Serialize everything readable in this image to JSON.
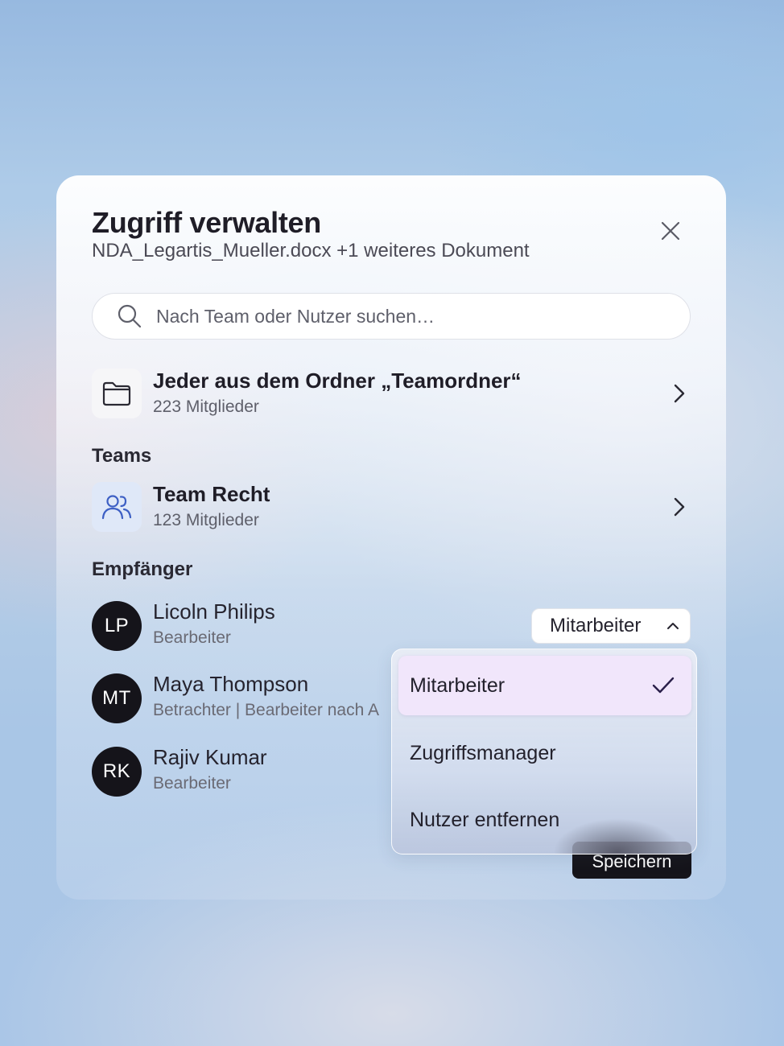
{
  "dialog": {
    "title": "Zugriff verwalten",
    "subtitle": "NDA_Legartis_Mueller.docx +1 weiteres Dokument"
  },
  "search": {
    "placeholder": "Nach Team oder Nutzer suchen…"
  },
  "folder": {
    "title": "Jeder aus dem Ordner „Teamordner“",
    "members": "223 Mitglieder"
  },
  "teams": {
    "label": "Teams",
    "items": [
      {
        "name": "Team Recht",
        "members": "123 Mitglieder"
      }
    ]
  },
  "recipients": {
    "label": "Empfänger",
    "items": [
      {
        "initials": "LP",
        "name": "Licoln Philips",
        "role": "Bearbeiter"
      },
      {
        "initials": "MT",
        "name": "Maya Thompson",
        "role": "Betrachter | Bearbeiter nach A"
      },
      {
        "initials": "RK",
        "name": "Rajiv Kumar",
        "role": "Bearbeiter"
      }
    ]
  },
  "role_select": {
    "value": "Mitarbeiter"
  },
  "dropdown": {
    "options": [
      {
        "label": "Mitarbeiter",
        "selected": true
      },
      {
        "label": "Zugriffsmanager",
        "selected": false
      },
      {
        "label": "Nutzer entfernen",
        "selected": false
      }
    ]
  },
  "actions": {
    "save_label": "Speichern"
  },
  "colors": {
    "accent_team_icon": "#3d5fc4",
    "avatar_bg": "#15141a",
    "selected_option_bg": "#f1e6fb",
    "check_color": "#2a1f4a"
  }
}
